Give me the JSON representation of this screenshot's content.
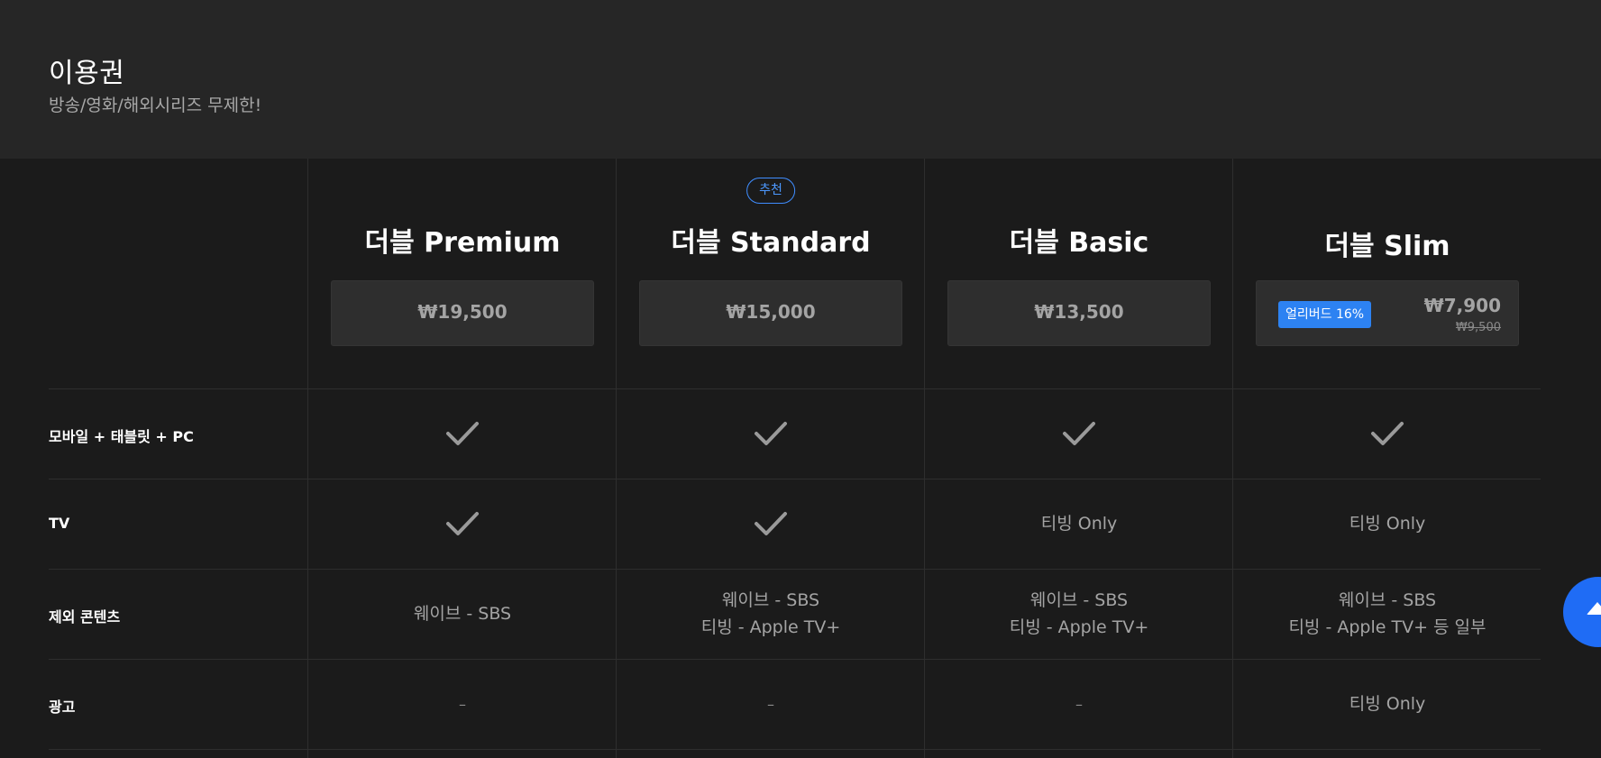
{
  "header": {
    "title": "이용권",
    "subtitle": "방송/영화/해외시리즈 무제한!"
  },
  "plans": [
    {
      "name": "더블 Premium",
      "price": "₩19,500"
    },
    {
      "name": "더블 Standard",
      "price": "₩15,000",
      "badge": "추천"
    },
    {
      "name": "더블 Basic",
      "price": "₩13,500"
    },
    {
      "name": "더블 Slim",
      "early_badge": "얼리버드 16%",
      "sale_price": "₩7,900",
      "original_price": "₩9,500"
    }
  ],
  "rows": [
    {
      "label": "모바일 + 태블릿 + PC",
      "cells": [
        "check",
        "check",
        "check",
        "check"
      ]
    },
    {
      "label": "TV",
      "cells": [
        "check",
        "check",
        "티빙 Only",
        "티빙 Only"
      ]
    },
    {
      "label": "제외 콘텐츠",
      "cells": [
        [
          "웨이브 - SBS"
        ],
        [
          "웨이브 - SBS",
          "티빙 - Apple TV+"
        ],
        [
          "웨이브 - SBS",
          "티빙 - Apple TV+"
        ],
        [
          "웨이브 - SBS",
          "티빙 - Apple TV+ 등 일부"
        ]
      ]
    },
    {
      "label": "광고",
      "cells": [
        "–",
        "–",
        "–",
        "티빙 Only"
      ]
    }
  ],
  "icons": {
    "check": "checkmark-icon",
    "scroll_top": "arrow-up-icon"
  },
  "colors": {
    "accent": "#2d82f2",
    "badge_outline": "#3f8dff",
    "scroll_button": "#1f6cf5"
  }
}
